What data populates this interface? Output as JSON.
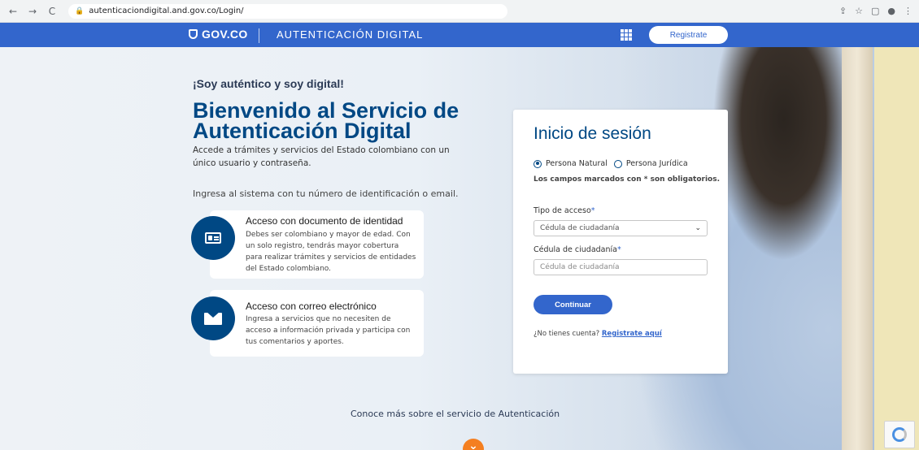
{
  "browser": {
    "url": "autenticaciondigital.and.gov.co/Login/",
    "back": "←",
    "forward": "→",
    "reload": "C"
  },
  "govbar": {
    "logo": "GOV.CO",
    "title": "AUTENTICACIÓN DIGITAL",
    "register_label": "Registrate"
  },
  "hero": {
    "tagline": "¡Soy auténtico y soy digital!",
    "headline": "Bienvenido al Servicio de Autenticación Digital",
    "subtext": "Accede a trámites y servicios del Estado colombiano con un único usuario y contraseña.",
    "ingresa": "Ingresa al sistema con tu número de identificación o email.",
    "cards": [
      {
        "title": "Acceso con documento de identidad",
        "desc": "Debes ser colombiano y mayor de edad. Con un solo registro, tendrás mayor cobertura para realizar trámites y servicios de entidades del Estado colombiano."
      },
      {
        "title": "Acceso con correo electrónico",
        "desc": "Ingresa a servicios que no necesiten de acceso a información privada y participa con tus comentarios y aportes."
      }
    ],
    "conoce": "Conoce más sobre el servicio de Autenticación"
  },
  "login": {
    "title": "Inicio de sesión",
    "radio_natural": "Persona Natural",
    "radio_juridica": "Persona Jurídica",
    "required_note": "Los campos marcados con * son obligatorios.",
    "tipo_label": "Tipo de acceso",
    "tipo_value": "Cédula de ciudadanía",
    "cedula_label": "Cédula de ciudadanía",
    "cedula_placeholder": "Cédula de ciudadanía",
    "asterisk": "*",
    "continue_label": "Continuar",
    "no_account": "¿No tienes cuenta?",
    "register_link": "Registrate aquí"
  },
  "icons": [
    "back-icon",
    "forward-icon",
    "reload-icon",
    "lock-icon",
    "apps-grid-icon",
    "id-card-icon",
    "mail-icon",
    "chevron-down-icon",
    "recaptcha-icon"
  ],
  "colors": {
    "gov_blue": "#3366cc",
    "heading_blue": "#004884",
    "orange": "#f47f20"
  }
}
